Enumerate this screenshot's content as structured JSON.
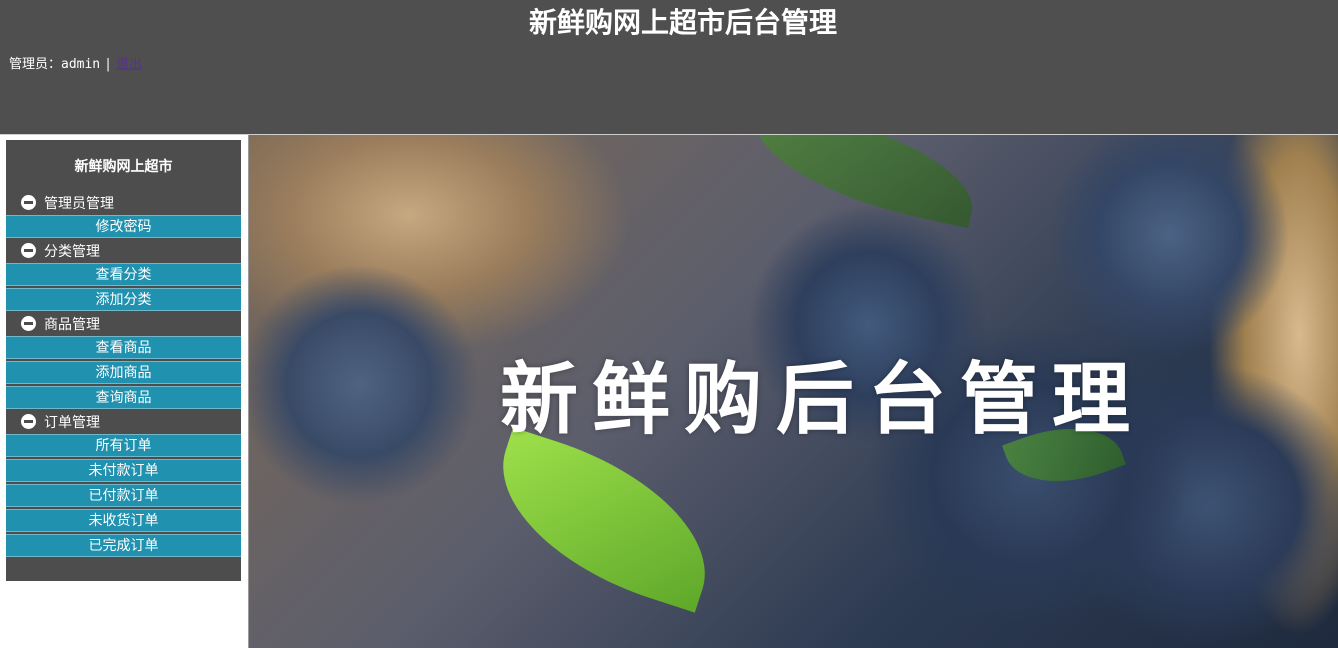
{
  "header": {
    "title": "新鲜购网上超市后台管理",
    "admin_label": "管理员：admin",
    "separator": "|",
    "logout": "退出"
  },
  "sidebar": {
    "title": "新鲜购网上超市",
    "groups": [
      {
        "label": "管理员管理",
        "items": [
          "修改密码"
        ]
      },
      {
        "label": "分类管理",
        "items": [
          "查看分类",
          "添加分类"
        ]
      },
      {
        "label": "商品管理",
        "items": [
          "查看商品",
          "添加商品",
          "查询商品"
        ]
      },
      {
        "label": "订单管理",
        "items": [
          "所有订单",
          "未付款订单",
          "已付款订单",
          "未收货订单",
          "已完成订单"
        ]
      }
    ]
  },
  "banner": {
    "text": "新鲜购后台管理"
  },
  "colors": {
    "header_bg": "#4f4f4f",
    "sidebar_bg": "#4d4d4d",
    "menu_item_bg": "#2191b0",
    "link": "#5a2d9c"
  },
  "icons": {
    "group_collapse": "minus-circle-icon"
  }
}
